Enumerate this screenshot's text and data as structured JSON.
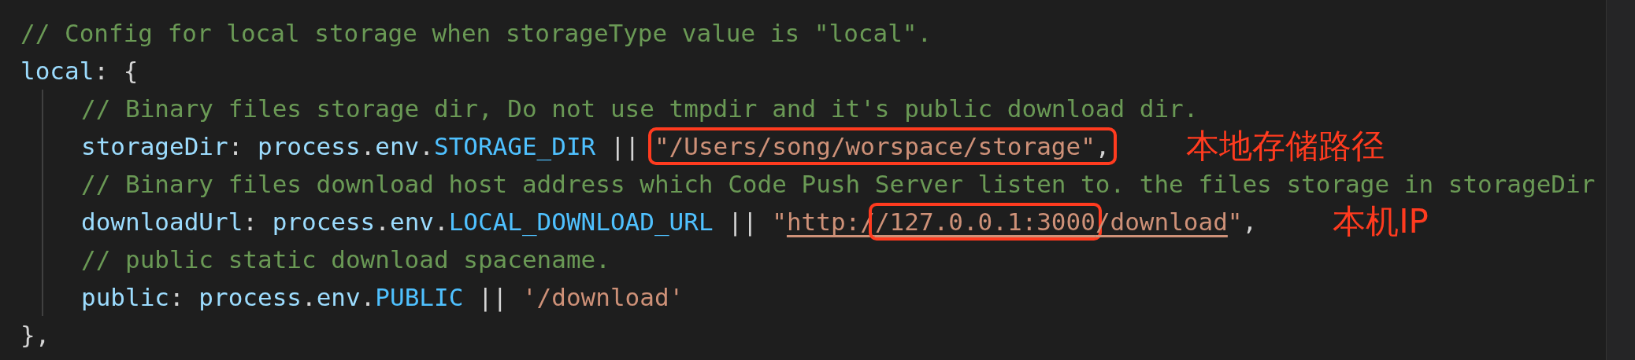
{
  "editor": {
    "lines": [
      {
        "tokens": [
          {
            "kind": "comment",
            "text": "// Config for local storage when storageType value is \"local\"."
          }
        ]
      },
      {
        "tokens": [
          {
            "kind": "key",
            "text": "local"
          },
          {
            "kind": "punct",
            "text": ": {"
          }
        ],
        "children": [
          {
            "tokens": [
              {
                "kind": "comment",
                "text": "// Binary files storage dir, Do not use tmpdir and it's public download dir."
              }
            ]
          },
          {
            "tokens": [
              {
                "kind": "key",
                "text": "storageDir"
              },
              {
                "kind": "punct",
                "text": ": "
              },
              {
                "kind": "key",
                "text": "process"
              },
              {
                "kind": "punct",
                "text": "."
              },
              {
                "kind": "key",
                "text": "env"
              },
              {
                "kind": "punct",
                "text": "."
              },
              {
                "kind": "const",
                "text": "STORAGE_DIR"
              },
              {
                "kind": "punct",
                "text": " || "
              },
              {
                "kind": "box",
                "tokens": [
                  {
                    "kind": "string",
                    "text": "\"/Users/song/worspace/storage\""
                  },
                  {
                    "kind": "punct",
                    "text": ","
                  }
                ]
              }
            ],
            "note": "本地存储路径"
          },
          {
            "tokens": [
              {
                "kind": "comment",
                "text": "// Binary files download host address which Code Push Server listen to. the files storage in storageDir"
              }
            ]
          },
          {
            "tokens": [
              {
                "kind": "key",
                "text": "downloadUrl"
              },
              {
                "kind": "punct",
                "text": ": "
              },
              {
                "kind": "key",
                "text": "process"
              },
              {
                "kind": "punct",
                "text": "."
              },
              {
                "kind": "key",
                "text": "env"
              },
              {
                "kind": "punct",
                "text": "."
              },
              {
                "kind": "const",
                "text": "LOCAL_DOWNLOAD_URL"
              },
              {
                "kind": "punct",
                "text": " || "
              },
              {
                "kind": "string",
                "text": "\""
              },
              {
                "kind": "link",
                "text": "http:/"
              },
              {
                "kind": "box",
                "tokens": [
                  {
                    "kind": "link",
                    "text": "/127.0.0.1:3000"
                  }
                ]
              },
              {
                "kind": "link",
                "text": "/download"
              },
              {
                "kind": "string",
                "text": "\""
              },
              {
                "kind": "punct",
                "text": ","
              }
            ],
            "note": "本机IP"
          },
          {
            "tokens": [
              {
                "kind": "comment",
                "text": "// public static download spacename."
              }
            ]
          },
          {
            "tokens": [
              {
                "kind": "key",
                "text": "public"
              },
              {
                "kind": "punct",
                "text": ": "
              },
              {
                "kind": "key",
                "text": "process"
              },
              {
                "kind": "punct",
                "text": "."
              },
              {
                "kind": "key",
                "text": "env"
              },
              {
                "kind": "punct",
                "text": "."
              },
              {
                "kind": "const",
                "text": "PUBLIC"
              },
              {
                "kind": "punct",
                "text": " || "
              },
              {
                "kind": "string",
                "text": "'/download'"
              }
            ]
          }
        ]
      },
      {
        "tokens": [
          {
            "kind": "punct",
            "text": "},"
          }
        ]
      }
    ]
  }
}
